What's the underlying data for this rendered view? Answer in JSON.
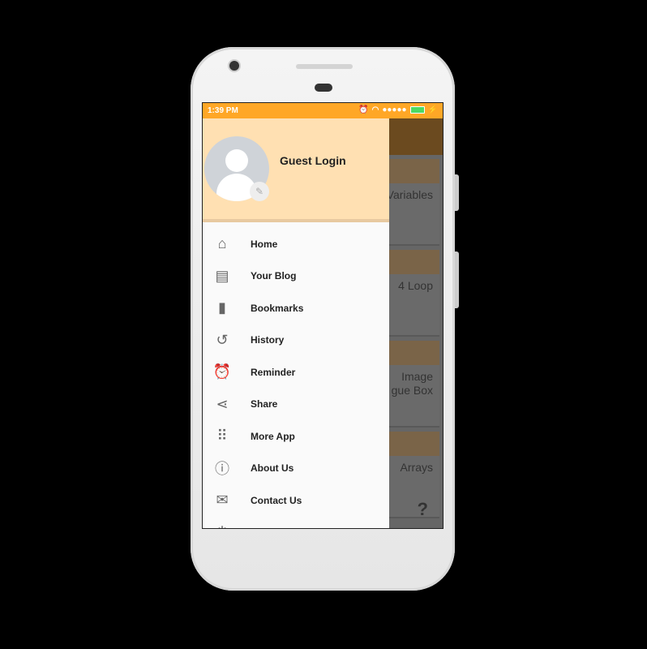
{
  "status_bar": {
    "time": "1:39 PM"
  },
  "drawer": {
    "user_name": "Guest Login",
    "items": [
      {
        "label": "Home",
        "icon": "home-icon",
        "glyph": "⌂"
      },
      {
        "label": "Your Blog",
        "icon": "blog-icon",
        "glyph": "▤"
      },
      {
        "label": "Bookmarks",
        "icon": "bookmark-icon",
        "glyph": "▮"
      },
      {
        "label": "History",
        "icon": "history-icon",
        "glyph": "↺"
      },
      {
        "label": "Reminder",
        "icon": "alarm-icon",
        "glyph": "⏰"
      },
      {
        "label": "Share",
        "icon": "share-icon",
        "glyph": "⋖"
      },
      {
        "label": "More App",
        "icon": "apps-grid-icon",
        "glyph": "⠿"
      },
      {
        "label": "About Us",
        "icon": "info-icon",
        "glyph": "ⓘ"
      },
      {
        "label": "Contact Us",
        "icon": "mail-icon",
        "glyph": "✉"
      },
      {
        "label": "",
        "icon": "power-icon",
        "glyph": "⏻"
      }
    ]
  },
  "background_cards": [
    "Variables",
    "4 Loop",
    "Image\ngue Box",
    "Arrays"
  ],
  "colors": {
    "status_bar": "#FFA726",
    "drawer_header": "#FFE0B2"
  }
}
